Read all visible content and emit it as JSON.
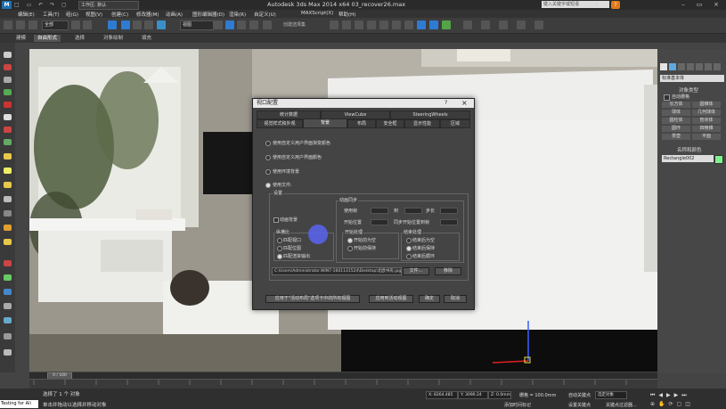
{
  "titlebar": {
    "workspace": "工作区: 默认",
    "title": "Autodesk 3ds Max  2014 x64      03_recover26.max",
    "search_placeholder": "键入关键字或短语",
    "help_label": "?"
  },
  "menubar": {
    "items": [
      "编辑(E)",
      "工具(T)",
      "组(G)",
      "视图(V)",
      "创建(C)",
      "修改器(M)",
      "动画(A)",
      "图形编辑器(D)",
      "渲染(R)",
      "自定义(U)",
      "MAXScript(X)",
      "帮助(H)"
    ]
  },
  "toolbar": {
    "selection_filter": "全部",
    "reference_coord": "视图",
    "named_selection": "创建选择集"
  },
  "ribbon": {
    "tabs": [
      "建模",
      "自由形式",
      "选择",
      "对象绘制",
      "填充"
    ],
    "active": "自由形式"
  },
  "command_panel": {
    "category": "标准基本体",
    "object_type_title": "对象类型",
    "autogrid": "自动栅格",
    "objects": [
      "长方体",
      "圆锥体",
      "球体",
      "几何球体",
      "圆柱体",
      "管状体",
      "圆环",
      "四棱锥",
      "茶壶",
      "平面"
    ],
    "name_color_title": "名称和颜色",
    "object_name": "Rectangle002",
    "swatch_color": "#7ff08e"
  },
  "dialog": {
    "title": "视口配置",
    "tabs_row1": [
      "统计数据",
      "ViewCube",
      "SteeringWheels"
    ],
    "tabs_row2": [
      "视觉样式和外观",
      "背景",
      "布局",
      "安全框",
      "显示性能",
      "区域"
    ],
    "active_tab": "背景",
    "radio_options": [
      "使用自定义用户界面渐变颜色",
      "使用自定义用户界面颜色",
      "使用环境背景",
      "使用文件:"
    ],
    "settings_label": "设置",
    "animate_bg": "动画背景",
    "aspect_title": "纵横比",
    "aspect_options": [
      "匹配视口",
      "匹配位图",
      "匹配渲染输出"
    ],
    "anim_sync_title": "动画同步",
    "use_frame": "使用帧",
    "to": "到",
    "step": "步长",
    "start_at": "开始位置",
    "sync_frame": "同步开始位置到帧",
    "start_proc_title": "开始处理",
    "start_options": [
      "开始前为空",
      "开始前保持"
    ],
    "end_proc_title": "结束处理",
    "end_options": [
      "结束后为空",
      "结束后保持",
      "结束后循环"
    ],
    "file_path": "C:\\Users\\Administrator.WIN7-1601131524\\Desktop\\北欧书房.jpg",
    "files_btn": "文件...",
    "remove_btn": "移除",
    "apply_all_btn": "应用于\"活动布局\"选项卡中的所有视图",
    "apply_active_btn": "应用到活动视图",
    "ok_btn": "确定",
    "cancel_btn": "取消",
    "help_mark": "?",
    "close_mark": "×"
  },
  "timeline": {
    "frame_label": "0 / 100"
  },
  "status": {
    "selected": "选择了 1 个 对象",
    "prompt": "单击并拖动以选择并移动对象",
    "maxscript": "Testing for Ali",
    "x": "X: 8264.485",
    "y": "Y: 3090.24",
    "z": "Z: 0.0mm",
    "grid": "栅格 = 100.0mm",
    "auto_key": "自动关键点",
    "selected_obj": "选定对象",
    "set_key": "设置关键点",
    "key_filter": "关键点过滤器...",
    "add_time_tag": "添加时间标记"
  }
}
